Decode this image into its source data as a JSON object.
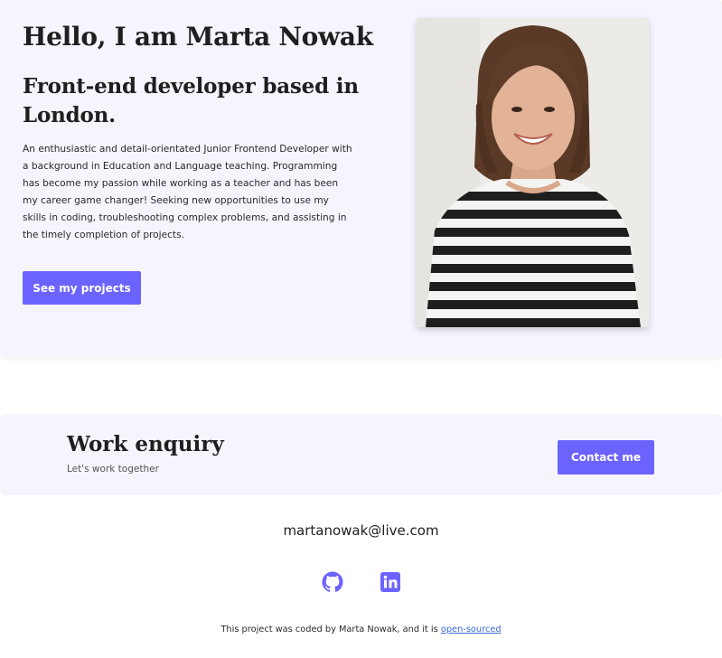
{
  "hero": {
    "title": "Hello, I am Marta Nowak",
    "subtitle": "Front-end developer based in London.",
    "bio": "An enthusiastic and detail-orientated Junior Frontend Developer with a background in Education and Language teaching. Programming has become my passion while working as a teacher and has been my career game changer! Seeking new opportunities to use my skills in coding, troubleshooting complex problems, and assisting in the timely completion of projects.",
    "projects_button": "See my projects"
  },
  "enquiry": {
    "title": "Work enquiry",
    "subtitle": "Let's work together",
    "contact_button": "Contact me"
  },
  "contact": {
    "email": "martanowak@live.com"
  },
  "social": {
    "icons": [
      "github-icon",
      "linkedin-icon"
    ]
  },
  "footer": {
    "note": "This project was coded by Marta Nowak, and it is",
    "link_label": "open-sourced"
  },
  "colors": {
    "accent": "#6c63ff",
    "panel_bg": "#f6f4fd",
    "link": "#3b6ad6",
    "text": "#1f1f1f"
  }
}
